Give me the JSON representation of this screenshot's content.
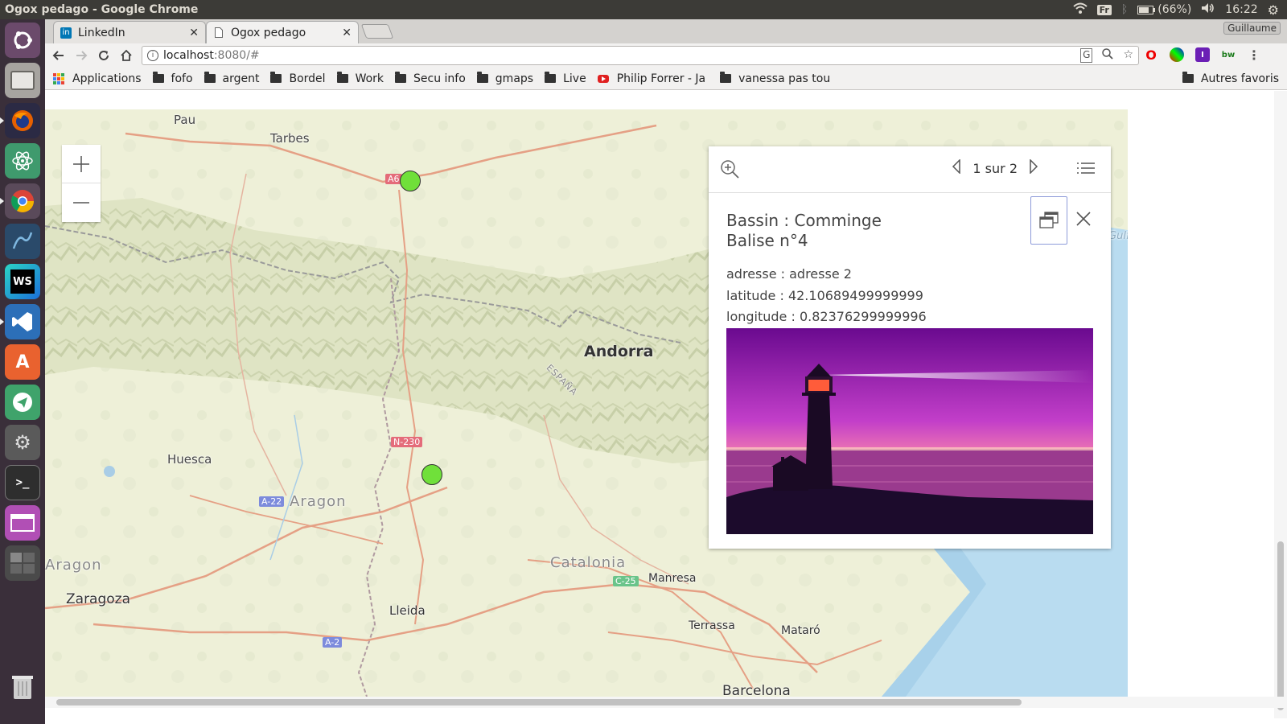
{
  "os_panel": {
    "window_title": "Ogox pedago - Google Chrome",
    "keyboard_layout": "Fr",
    "battery": "(66%)",
    "clock": "16:22"
  },
  "launcher": {
    "apps": [
      "ubuntu-dash",
      "files",
      "firefox",
      "atom",
      "chrome",
      "mysql-workbench",
      "webstorm",
      "vscode",
      "software-center",
      "telegram",
      "settings",
      "terminal",
      "app-window",
      "workspace-switcher",
      "trash"
    ]
  },
  "browser": {
    "tabs": [
      {
        "label": "LinkedIn",
        "favicon": "linkedin-icon"
      },
      {
        "label": "Ogox pedago",
        "favicon": "page-icon"
      }
    ],
    "user": "Guillaume",
    "url_host": "localhost",
    "url_rest": ":8080/#",
    "bookmarks": {
      "apps": "Applications",
      "items": [
        "fofo",
        "argent",
        "Bordel",
        "Work",
        "Secu info",
        "gmaps",
        "Live"
      ],
      "youtube": "Philip Forrer - Ja",
      "vanessa": "vanessa pas tou",
      "other": "Autres favoris"
    }
  },
  "map": {
    "labels": {
      "pau": "Pau",
      "tarbes": "Tarbes",
      "andorra": "Andorra",
      "espana": "ESPAÑA",
      "huesca": "Huesca",
      "aragon": "Aragon",
      "aragon2": "Aragon",
      "a22": "A-22",
      "n230": "N-230",
      "a6": "A6",
      "catalonia": "Catalonia",
      "c25": "C-25",
      "manresa": "Manresa",
      "zaragoza": "Zaragoza",
      "lleida": "Lleida",
      "terrassa": "Terrassa",
      "mataro": "Mataró",
      "barcelona": "Barcelona",
      "a2": "A-2",
      "golf": "Gulf"
    },
    "colors": {
      "marker": "#70e03a",
      "water": "#b9dcf0"
    }
  },
  "popup": {
    "pager": "1 sur 2",
    "title_line1": "Bassin : Comminge",
    "title_line2": "Balise n°4",
    "adresse": "adresse : adresse 2",
    "latitude": "latitude : 42.10689499999999",
    "longitude": "longitude : 0.82376299999996"
  }
}
